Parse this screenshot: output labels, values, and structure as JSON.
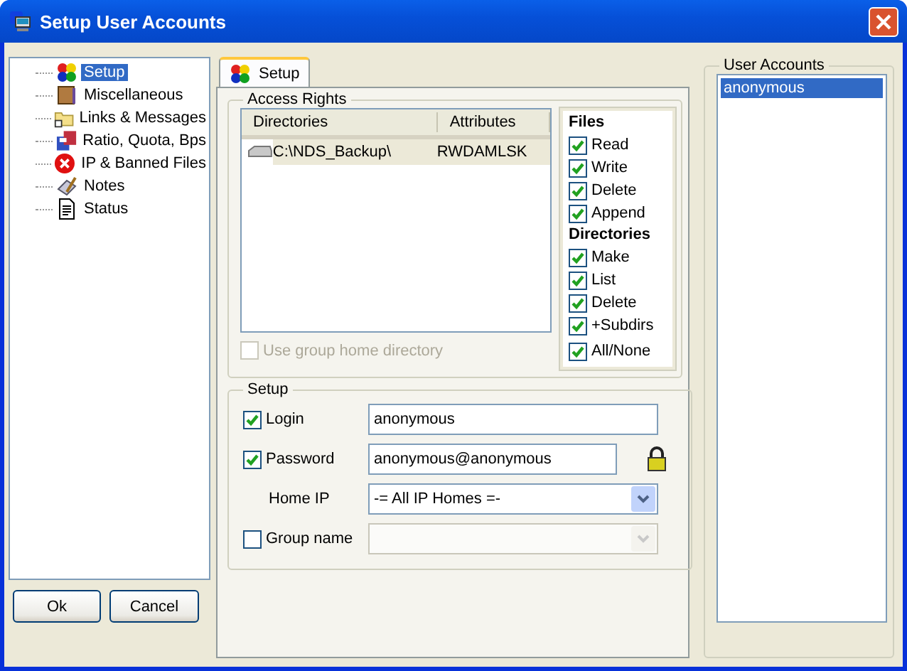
{
  "window": {
    "title": "Setup User Accounts"
  },
  "tree": [
    {
      "label": "Setup",
      "selected": true
    },
    {
      "label": "Miscellaneous",
      "selected": false
    },
    {
      "label": "Links & Messages",
      "selected": false
    },
    {
      "label": "Ratio, Quota, Bps",
      "selected": false
    },
    {
      "label": "IP & Banned Files",
      "selected": false
    },
    {
      "label": "Notes",
      "selected": false
    },
    {
      "label": "Status",
      "selected": false
    }
  ],
  "buttons": [
    "Ok",
    "Cancel"
  ],
  "tabs": [
    {
      "label": "Setup",
      "selected": true
    }
  ],
  "access_rights": {
    "title": "Access Rights",
    "table": {
      "columns": [
        "Directories",
        "Attributes"
      ],
      "rows": [
        {
          "directory": "C:\\NDS_Backup\\",
          "attributes": "RWDAMLSK",
          "selected": true
        }
      ]
    },
    "use_group_home": {
      "label": "Use group home directory",
      "checked": false,
      "disabled": true
    },
    "files": {
      "title": "Files",
      "items": [
        {
          "label": "Read",
          "checked": true
        },
        {
          "label": "Write",
          "checked": true
        },
        {
          "label": "Delete",
          "checked": true
        },
        {
          "label": "Append",
          "checked": true
        }
      ]
    },
    "directories": {
      "title": "Directories",
      "items": [
        {
          "label": "Make",
          "checked": true
        },
        {
          "label": "List",
          "checked": true
        },
        {
          "label": "Delete",
          "checked": true
        },
        {
          "label": "+Subdirs",
          "checked": true
        },
        {
          "label": "All/None",
          "checked": true
        }
      ]
    }
  },
  "setup": {
    "title": "Setup",
    "login": {
      "label": "Login",
      "checked": true,
      "value": "anonymous"
    },
    "password": {
      "label": "Password",
      "checked": true,
      "value": "anonymous@anonymous"
    },
    "home_ip": {
      "label": "Home IP",
      "value": "-= All IP Homes =-"
    },
    "group_name": {
      "label": "Group name",
      "checked": false,
      "disabled": true
    }
  },
  "user_accounts": {
    "title": "User Accounts",
    "items": [
      {
        "label": "anonymous",
        "selected": true
      }
    ]
  }
}
